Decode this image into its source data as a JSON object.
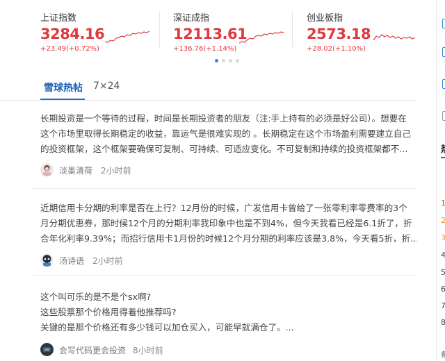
{
  "indices": [
    {
      "name": "上证指数",
      "value": "3284.16",
      "change": "+23.49(+0.72%)"
    },
    {
      "name": "深证成指",
      "value": "12113.61",
      "change": "+136.76(+1.14%)"
    },
    {
      "name": "创业板指",
      "value": "2573.18",
      "change": "+28.02(+1.10%)"
    }
  ],
  "tabs": [
    {
      "label": "雪球热帖"
    },
    {
      "label": "7×24"
    }
  ],
  "posts": [
    {
      "lines": [
        "长期投资是一个等待的过程，时间是长期投资者的朋友（注:手上持有的必须是好公司）。想要在",
        "这个市场里取得长期稳定的收益，靠运气是很难实现的 。长期稳定在这个市场盈利需要建立自己",
        "的投资框架，这个框架要确保可复制、可持续、可适应变化。不可复制和持续的投资框架都不..."
      ],
      "author": "淡墨清荷",
      "time": "2小时前"
    },
    {
      "lines": [
        "近期信用卡分期的利率是否在上行？12月份的时候，广发信用卡曾给了一张零利率零费率的3个",
        "月分期优惠券，那时候12个月的分期利率我印象中也是不到4%，但今天我看已经是6.1折了，折",
        "合年化利率9.39%；而招行信用卡1月份的时候12个月分期的利率应该是3.8%，今天看5折，折..."
      ],
      "author": "汤诗语",
      "time": "2小时前"
    },
    {
      "lines": [
        "这个叫可乐的是不是个sx啊?",
        "这些股票那个价格用得着他推荐吗?",
        "关键的是那个价格还有多少钱可以加仓买入，可能早就满仓了。..."
      ],
      "author": "会写代码更会投资",
      "time": "8小时前"
    }
  ],
  "right_panel": {
    "rank_numbers": [
      "1",
      "2",
      "3",
      "4",
      "5",
      "6",
      "7",
      "8"
    ],
    "partial_heading": "热",
    "partial_footer": "备"
  },
  "colors": {
    "up": "#e0393e",
    "accent": "#1a6ed8",
    "text": "#444444"
  }
}
